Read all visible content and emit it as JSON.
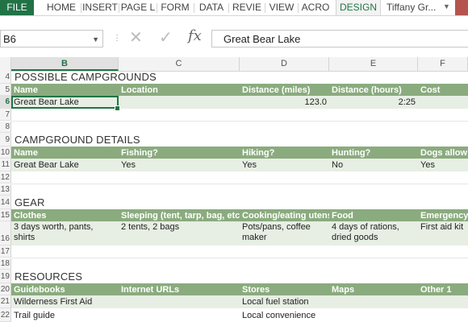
{
  "ribbon": {
    "tabs": [
      "FILE",
      "HOME",
      "INSERT",
      "PAGE L",
      "FORM",
      "DATA",
      "REVIE",
      "VIEW",
      "ACRO",
      "DESIGN"
    ],
    "user": "Tiffany Gr...",
    "colors": {
      "file_bg": "#217346",
      "header_band": "#8aab7e",
      "data_band": "#e7efe4"
    }
  },
  "formula_bar": {
    "name_box": "B6",
    "formula": "Great Bear Lake",
    "icons": [
      "cancel-icon",
      "enter-icon",
      "fx-icon"
    ]
  },
  "columns": [
    "B",
    "C",
    "D",
    "E",
    "F"
  ],
  "rows": {
    "r4": {
      "num": "4",
      "title": "POSSIBLE CAMPGROUNDS"
    },
    "r5": {
      "num": "5",
      "cells": [
        "Name",
        "Location",
        "Distance (miles)",
        "Distance (hours)",
        "Cost"
      ]
    },
    "r6": {
      "num": "6",
      "cells": [
        "Great Bear Lake",
        "",
        "123.0",
        "2:25",
        ""
      ]
    },
    "r7": {
      "num": "7"
    },
    "r8": {
      "num": "8"
    },
    "r9": {
      "num": "9",
      "title": "CAMPGROUND DETAILS"
    },
    "r10": {
      "num": "10",
      "cells": [
        "Name",
        "Fishing?",
        "Hiking?",
        "Hunting?",
        "Dogs allow"
      ]
    },
    "r11": {
      "num": "11",
      "cells": [
        "Great Bear Lake",
        "Yes",
        "Yes",
        "No",
        "Yes"
      ]
    },
    "r12": {
      "num": "12"
    },
    "r13": {
      "num": "13"
    },
    "r14": {
      "num": "14",
      "title": "GEAR"
    },
    "r15": {
      "num": "15",
      "cells": [
        "Clothes",
        "Sleeping (tent, tarp, bag, etc.)",
        "Cooking/eating utens",
        "Food",
        "Emergency"
      ]
    },
    "r16": {
      "num": "16",
      "cells": [
        "3 days worth, pants, shirts",
        "2 tents, 2 bags",
        "Pots/pans, coffee maker",
        "4 days of rations, dried goods",
        "First aid kit"
      ]
    },
    "r17": {
      "num": "17"
    },
    "r18": {
      "num": "18"
    },
    "r19": {
      "num": "19",
      "title": "RESOURCES"
    },
    "r20": {
      "num": "20",
      "cells": [
        "Guidebooks",
        "Internet URLs",
        "Stores",
        "Maps",
        "Other 1"
      ]
    },
    "r21": {
      "num": "21",
      "cells": [
        "Wilderness First Aid",
        "",
        "Local fuel station",
        "",
        ""
      ]
    },
    "r22": {
      "num": "22",
      "cells": [
        "Trail guide",
        "",
        "Local convenience",
        "",
        ""
      ]
    }
  }
}
